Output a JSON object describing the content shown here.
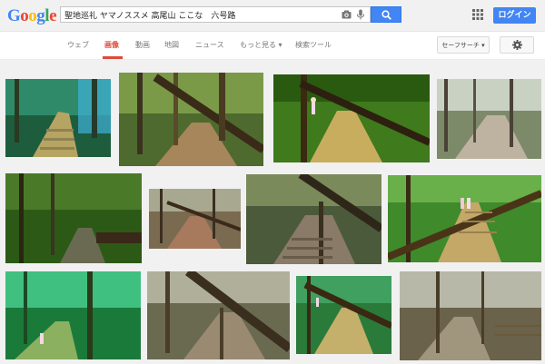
{
  "logo": {
    "letters": [
      "G",
      "o",
      "o",
      "g",
      "l",
      "e"
    ],
    "colors": [
      "#4285f4",
      "#ea4335",
      "#fbbc05",
      "#4285f4",
      "#34a853",
      "#ea4335"
    ]
  },
  "search": {
    "query": "聖地巡礼 ヤマノススメ 高尾山 ここな　六号路"
  },
  "header": {
    "login_label": "ログイン"
  },
  "nav": {
    "tabs": [
      {
        "label": "ウェブ"
      },
      {
        "label": "画像"
      },
      {
        "label": "動画"
      },
      {
        "label": "地図"
      },
      {
        "label": "ニュース"
      },
      {
        "label": "もっと見る ▾"
      },
      {
        "label": "検索ツール"
      }
    ],
    "safe_search_label": "セーフサーチ ▾"
  },
  "colors": {
    "accent": "#4285f4",
    "active_tab": "#dd4b39"
  },
  "thumbnails": [
    {
      "id": "t1",
      "desc": "anime forest path with stone steps"
    },
    {
      "id": "t2",
      "desc": "forest trail with fallen tree trunk"
    },
    {
      "id": "t3",
      "desc": "anime forest path with girl and fallen tree"
    },
    {
      "id": "t4",
      "desc": "bright woodland path"
    },
    {
      "id": "t5",
      "desc": "dense green forest stream"
    },
    {
      "id": "t6",
      "desc": "dirt trail with fallen tree"
    },
    {
      "id": "t7",
      "desc": "stone steps under fallen tree"
    },
    {
      "id": "t8",
      "desc": "anime stairs with two girls"
    },
    {
      "id": "t9",
      "desc": "anime green forest with girl"
    },
    {
      "id": "t10",
      "desc": "forest trail with leaning trunk"
    },
    {
      "id": "t11",
      "desc": "anime path with fallen tree"
    },
    {
      "id": "t12",
      "desc": "woodland with fence"
    }
  ]
}
